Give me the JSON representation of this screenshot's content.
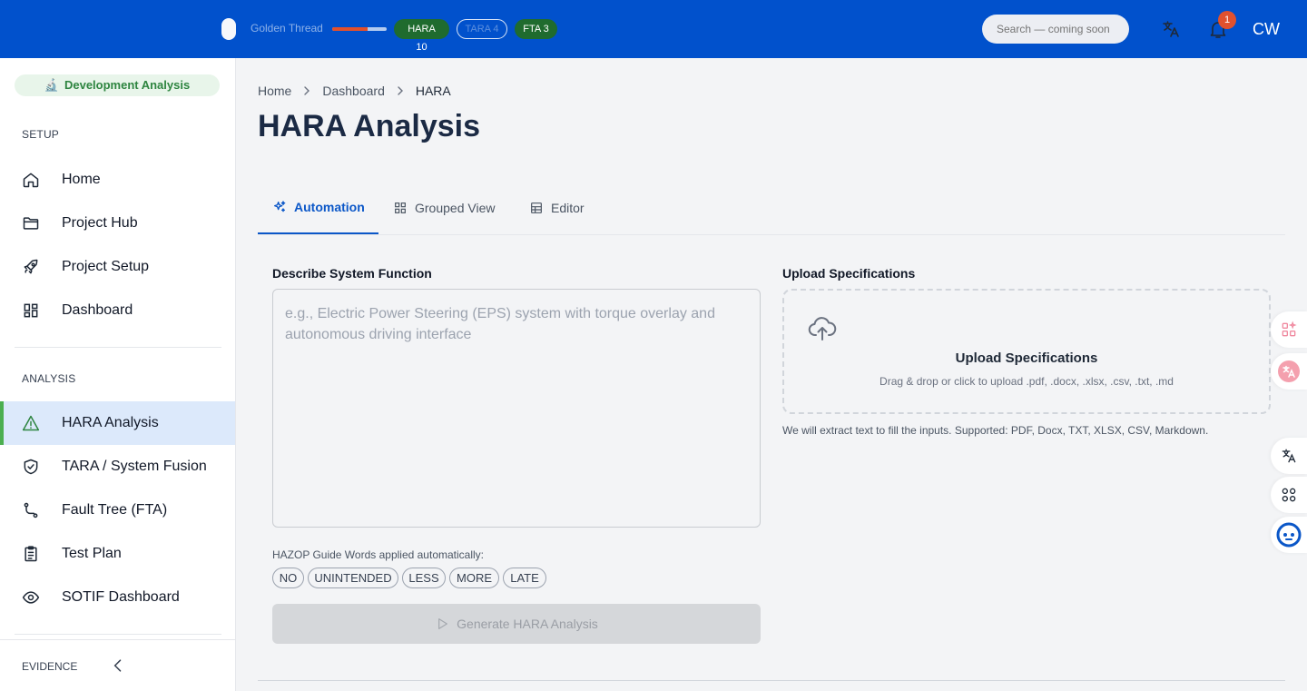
{
  "topbar": {
    "thread_label": "Golden Thread",
    "thread_progress": 0.65,
    "chips": {
      "hara": "HARA 10",
      "tara": "TARA 4",
      "fta": "FTA 3"
    },
    "search_placeholder": "Search — coming soon",
    "notifications_count": "1",
    "user_initials": "CW",
    "colors": {
      "bar": "#0151cc",
      "chip_green": "#1f6b2e",
      "badge": "#e0512e"
    }
  },
  "sidebar": {
    "context_pill": "Development Analysis",
    "setup_heading": "SETUP",
    "setup_items": [
      "Home",
      "Project Hub",
      "Project Setup",
      "Dashboard"
    ],
    "analysis_heading": "ANALYSIS",
    "analysis_items": [
      "HARA Analysis",
      "TARA / System Fusion",
      "Fault Tree (FTA)",
      "Test Plan",
      "SOTIF Dashboard"
    ],
    "active_item": "HARA Analysis",
    "evidence_heading": "EVIDENCE"
  },
  "breadcrumb": [
    "Home",
    "Dashboard",
    "HARA"
  ],
  "page_title": "HARA Analysis",
  "tabs": [
    "Automation",
    "Grouped View",
    "Editor"
  ],
  "active_tab": "Automation",
  "describe": {
    "label": "Describe System Function",
    "placeholder": "e.g., Electric Power Steering (EPS) system with torque overlay and autonomous driving interface",
    "value": ""
  },
  "hazop": {
    "label": "HAZOP Guide Words applied automatically:",
    "words": [
      "NO",
      "UNINTENDED",
      "LESS",
      "MORE",
      "LATE"
    ]
  },
  "generate_button": "Generate HARA Analysis",
  "upload": {
    "label": "Upload Specifications",
    "title": "Upload Specifications",
    "subtitle": "Drag & drop or click to upload .pdf, .docx, .xlsx, .csv, .txt, .md",
    "note": "We will extract text to fill the inputs. Supported: PDF, Docx, TXT, XLSX, CSV, Markdown."
  }
}
